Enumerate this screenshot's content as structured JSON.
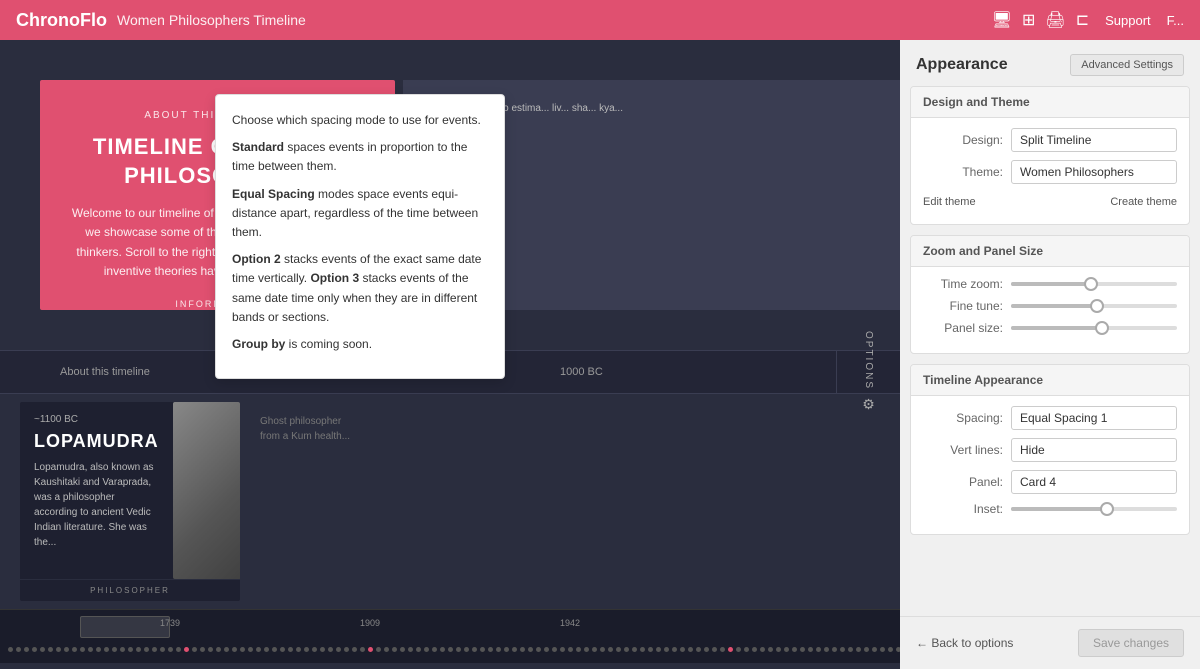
{
  "header": {
    "brand": "ChronoFlo",
    "timeline_title": "Women Philosophers Timeline",
    "support_label": "Support",
    "icons": [
      "monitor-icon",
      "layout-icon",
      "print-icon",
      "share-icon"
    ]
  },
  "tooltip": {
    "line1": "Choose which spacing mode to use for events.",
    "standard_bold": "Standard",
    "standard_text": " spaces events in proportion to the time between them.",
    "equal_bold": "Equal Spacing",
    "equal_text": " modes space events equi-distance apart, regardless of the time between them.",
    "option2_bold": "Option 2",
    "option2_text": " stacks events of the exact same date time vertically.",
    "option3_bold": " Option 3",
    "option3_text": " stacks events of the same date time only when they are in different bands or sections.",
    "groupby_bold": "Group by",
    "groupby_text": " is coming soon."
  },
  "intro_card": {
    "about_label": "About this timeline",
    "title": "Timeline of Women Philosophers",
    "description": "Welcome to our timeline of women philosophers. Here, we showcase some of the world's greatest female thinkers. Scroll to the right to meet the women whose inventive theories have enriched the world.",
    "info_label": "Information"
  },
  "ruler": {
    "labels": [
      "About this timeline",
      "~1100 BC",
      "1000 BC"
    ],
    "options_label": "Options"
  },
  "event_card": {
    "date": "~1100 BC",
    "name": "Lopamudra",
    "description": "Lopamudra, also known as Kaushitaki and Varaprada, was a philosopher according to ancient Vedic Indian literature. She was the...",
    "type_label": "Philosopher"
  },
  "ghost_card": {
    "text": "Ghost philosopher from a Kum health"
  },
  "scrubber": {
    "years": [
      "1739",
      "1909",
      "1942"
    ]
  },
  "panel": {
    "title": "Appearance",
    "advanced_btn": "Advanced Settings",
    "sections": {
      "design": {
        "title": "Design and Theme",
        "design_label": "Design:",
        "design_value": "Split Timeline",
        "theme_label": "Theme:",
        "theme_value": "Women Philosophers",
        "edit_theme_label": "Edit theme",
        "create_theme_label": "Create theme"
      },
      "zoom": {
        "title": "Zoom and Panel Size",
        "time_zoom_label": "Time zoom:",
        "time_zoom_pct": 48,
        "fine_tune_label": "Fine tune:",
        "fine_tune_pct": 52,
        "panel_size_label": "Panel size:",
        "panel_size_pct": 55
      },
      "timeline_appearance": {
        "title": "Timeline Appearance",
        "spacing_label": "Spacing:",
        "spacing_value": "Equal Spacing 1",
        "vert_lines_label": "Vert lines:",
        "vert_lines_value": "Hide",
        "panel_label": "Panel:",
        "panel_value": "Card 4",
        "inset_label": "Inset:",
        "inset_pct": 58
      }
    },
    "footer": {
      "back_label": "← Back to options",
      "save_label": "Save changes"
    }
  }
}
